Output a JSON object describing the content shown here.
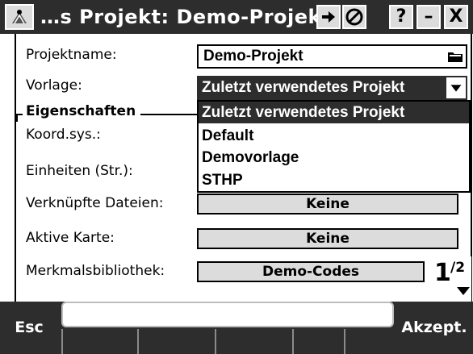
{
  "window": {
    "title": "…s Projekt: Demo-Projekt",
    "icons": [
      "app-menu-icon",
      "login-arrow-icon",
      "sensor-icon"
    ],
    "help_label": "?",
    "minimize_label": "–",
    "close_label": "X"
  },
  "form": {
    "projektname_label": "Projektname:",
    "projektname_value": "Demo-Projekt",
    "vorlage_label": "Vorlage:",
    "vorlage_value": "Zuletzt verwendetes Projekt",
    "group_title": "Eigenschaften",
    "koordsys_label": "Koord.sys.:",
    "einheiten_label": "Einheiten (Str.):",
    "dateien_label": "Verknüpfte Dateien:",
    "dateien_value": "Keine",
    "karte_label": "Aktive Karte:",
    "karte_value": "Keine",
    "bibliothek_label": "Merkmalsbibliothek:",
    "bibliothek_value": "Demo-Codes"
  },
  "dropdown": {
    "options": [
      "Zuletzt verwendetes Projekt",
      "Default",
      "Demovorlage",
      "STHP"
    ],
    "selected_index": 0
  },
  "pager": {
    "current": "1",
    "total": "/2"
  },
  "bottombar": {
    "esc_label": "Esc",
    "accept_label": "Akzept."
  },
  "colors": {
    "titlebar_bg": "#2d2d2d",
    "button_bg": "#dcdcdc",
    "selection_bg": "#2d2d2d"
  }
}
